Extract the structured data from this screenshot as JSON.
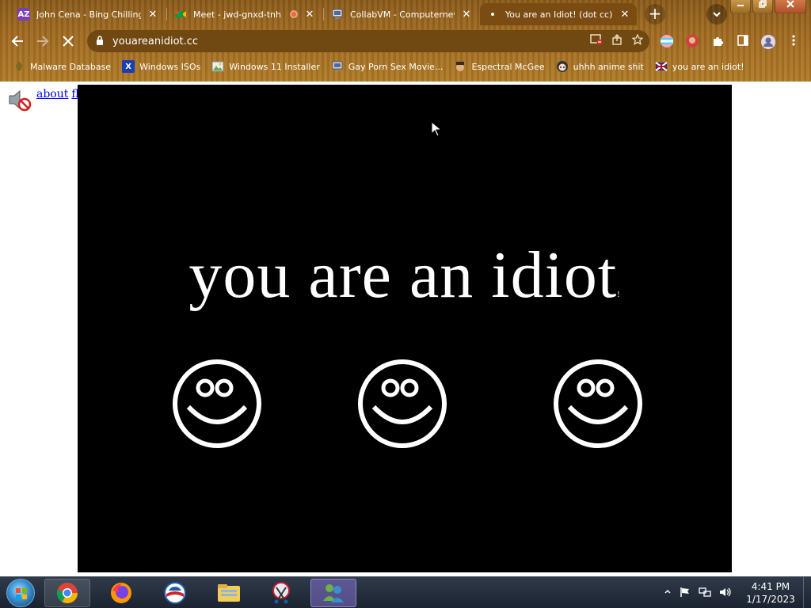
{
  "browser": {
    "tabs": [
      {
        "title": "John Cena - Bing Chilling",
        "favicon": "AZ",
        "favicon_color": "#7b3fb8",
        "active": false
      },
      {
        "title": "Meet - jwd-gnxd-tnh",
        "favicon": "meet-icon",
        "favicon_color": "#00a046",
        "active": false,
        "recording": true
      },
      {
        "title": "CollabVM - Computernewb",
        "favicon": "collabvm-icon",
        "favicon_color": "#d0d0e0",
        "active": false
      },
      {
        "title": "You are an Idiot! (dot cc)",
        "favicon": "loading-icon",
        "favicon_color": "#ffffff",
        "active": true
      }
    ],
    "tab_close_glyph": "✕",
    "new_tab_glyph": "+",
    "url": "youareanidiot.cc",
    "bookmarks": [
      {
        "label": "Malware Database",
        "icon": "leaf-icon",
        "color": "#2e7d32"
      },
      {
        "label": "Windows ISOs",
        "icon": "X",
        "color": "#1a3fb0"
      },
      {
        "label": "Windows 11 Installer",
        "icon": "image-icon",
        "color": "#6aa84f"
      },
      {
        "label": "Gay Porn Sex Movie...",
        "icon": "collabvm-icon",
        "color": "#c0c0d0"
      },
      {
        "label": "Espectral McGee",
        "icon": "face-icon",
        "color": "#8a5a3a"
      },
      {
        "label": "uhhh anime shit",
        "icon": "anime-icon",
        "color": "#333333"
      },
      {
        "label": "you are an idiot!",
        "icon": "flag-icon",
        "color": "#c01020"
      }
    ]
  },
  "page": {
    "links": [
      "about",
      "flash"
    ],
    "headline": "you are an idiot",
    "headline_suffix": "!",
    "smiley_count": 3
  },
  "taskbar": {
    "time": "4:41 PM",
    "date": "1/17/2023",
    "apps": [
      "chrome-icon",
      "firefox-icon",
      "obama-icon",
      "explorer-icon",
      "snipping-icon",
      "messenger-icon"
    ]
  }
}
